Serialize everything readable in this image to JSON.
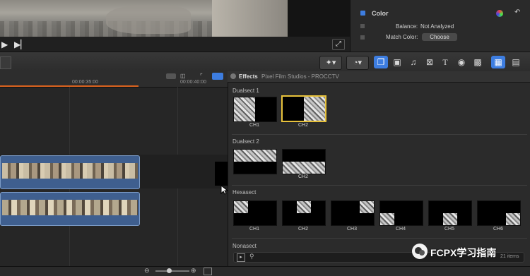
{
  "inspector": {
    "section_title": "Color",
    "balance_label": "Balance:",
    "balance_value": "Not Analyzed",
    "match_color_label": "Match Color:",
    "choose_button": "Choose"
  },
  "timeline": {
    "timecode_1": "00:00:35:00",
    "timecode_2": "00:00:40:00"
  },
  "effects": {
    "title": "Effects",
    "breadcrumb": "Pixel Film Studios - PROCCTV",
    "sections": [
      {
        "title": "Dualsect 1",
        "items": [
          "CH1",
          "CH2"
        ]
      },
      {
        "title": "Dualsect 2",
        "items": [
          "",
          "CH2"
        ]
      },
      {
        "title": "Hexasect",
        "items": [
          "CH1",
          "CH2",
          "CH3",
          "CH4",
          "CH5",
          "CH6"
        ]
      },
      {
        "title": "Nonasect",
        "items": []
      }
    ],
    "item_count": "21 items"
  },
  "watermark": "FCPX学习指南",
  "icons": {
    "play": "play-icon",
    "next": "skip-forward-icon",
    "fullscreen": "fullscreen-icon",
    "magic_wand": "enhance-icon",
    "retime": "retime-icon",
    "effects_browser": "effects-browser-icon",
    "photo": "photo-browser-icon",
    "music": "music-browser-icon",
    "transitions": "transitions-browser-icon",
    "titles": "titles-browser-icon",
    "generators": "generators-browser-icon",
    "themes": "themes-browser-icon",
    "search": "search-icon"
  },
  "colors": {
    "accent_blue": "#3d7de0",
    "selection_yellow": "#e8c23c",
    "playrange_orange": "#d9621f"
  }
}
